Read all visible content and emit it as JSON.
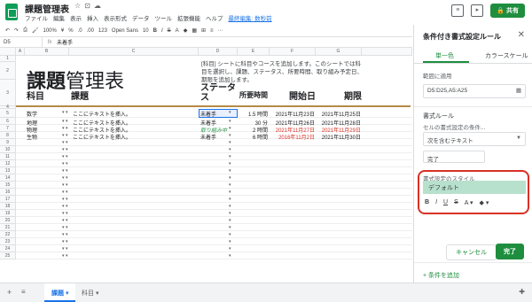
{
  "header": {
    "doc_title": "課題管理表",
    "menus": [
      "ファイル",
      "編集",
      "表示",
      "挿入",
      "表示形式",
      "データ",
      "ツール",
      "拡張機能",
      "ヘルプ"
    ],
    "last_edit": "最終編集: 数秒前",
    "share_label": "共有"
  },
  "toolbar": {
    "zoom": "100%",
    "currency": "¥",
    "percent": "%",
    "dec1": ".0",
    "dec2": ".00",
    "format": "123",
    "font": "Open Sans",
    "font_size": "10",
    "bold": "B",
    "italic": "I",
    "strike": "S",
    "textcolor": "A"
  },
  "formula_bar": {
    "cell_ref": "D5",
    "fx": "fx",
    "content": "未着手"
  },
  "sheet": {
    "columns": [
      "A",
      "B",
      "C",
      "D",
      "E",
      "F",
      "G"
    ],
    "rows": [
      "1",
      "2",
      "3",
      "4",
      "5",
      "6",
      "7",
      "8",
      "9",
      "10",
      "11",
      "12",
      "13",
      "14",
      "15",
      "16",
      "17",
      "18",
      "19",
      "20",
      "21",
      "22",
      "23",
      "24",
      "25"
    ],
    "title_bold": "課題",
    "title_rest": "管理表",
    "description": "[科目] シートに科目やコースを追加します。このシートでは科目を選択し、課題、ステータス、所要時間、取り組み予定日、期限を追加します。",
    "headers": {
      "subject": "科目",
      "task": "課題",
      "status": "ステータス",
      "duration": "所要時間",
      "start": "開始日",
      "due": "期限"
    },
    "data_rows": [
      {
        "subject": "数学",
        "task": "ここにテキストを挿入。",
        "status": "未着手",
        "duration": "1.5 時間",
        "start": "2021年11月23日",
        "due": "2021年11月25日"
      },
      {
        "subject": "地理",
        "task": "ここにテキストを挿入。",
        "status": "未着手",
        "duration": "30 分",
        "start": "2021年11月26日",
        "due": "2021年11月28日"
      },
      {
        "subject": "物理",
        "task": "ここにテキストを挿入。",
        "status": "取り組み中",
        "duration": "2 時間",
        "start": "2021年11月27日",
        "due": "2021年11月29日"
      },
      {
        "subject": "生物",
        "task": "ここにテキストを挿入。",
        "status": "未着手",
        "duration": "6 時間",
        "start": "2016年11月2日",
        "due": "2021年11月30日"
      }
    ]
  },
  "bottom_tabs": {
    "active": "課題",
    "other": "科目"
  },
  "panel": {
    "title": "条件付き書式設定ルール",
    "tab_single": "単一色",
    "tab_scale": "カラースケール",
    "range_label": "範囲に適用",
    "range_value": "D5:D25,A5:A25",
    "rules_label": "書式ルール",
    "condition_label": "セルの書式設定の条件...",
    "condition_value": "次を含むテキスト",
    "value_input": "完了",
    "style_label": "書式設定のスタイル",
    "style_value": "デフォルト",
    "cancel_label": "キャンセル",
    "done_label": "完了",
    "add_rule_label": "+ 条件を追加"
  },
  "colors": {
    "accent_green": "#1e8e3e",
    "highlight_red": "#d93025",
    "default_style_bg": "#b7e1cd",
    "header_line": "#b58a45"
  }
}
